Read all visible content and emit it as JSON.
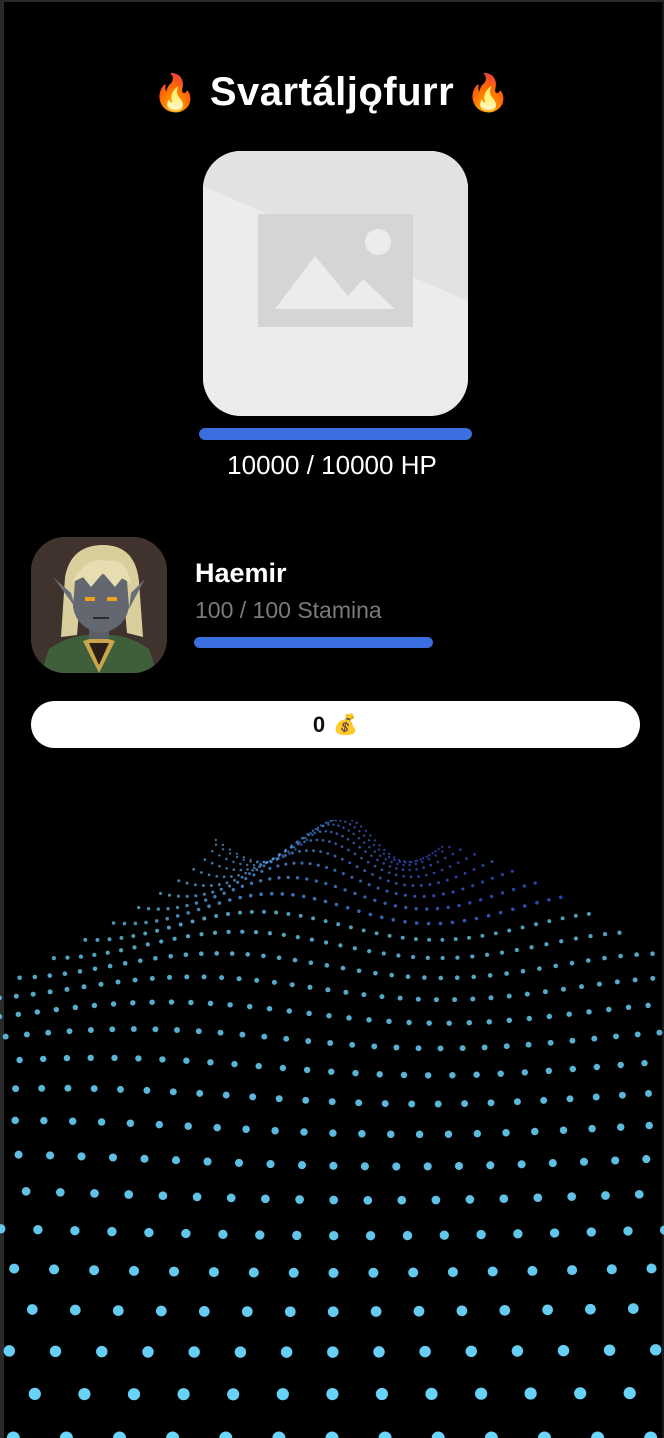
{
  "boss": {
    "title": "Svartáljǫfurr",
    "title_icon": "fire-icon",
    "title_emoji": "🔥",
    "image": "image-placeholder-icon",
    "hp_current": "10000",
    "hp_max": "10000",
    "hp_unit": "HP",
    "hp_separator": " / ",
    "hp_fraction": 1.0
  },
  "player": {
    "name": "Haemir",
    "avatar": "character-portrait",
    "stamina_current": "100",
    "stamina_max": "100",
    "stamina_unit": "Stamina",
    "stamina_separator": " / ",
    "stamina_fraction": 1.0
  },
  "gold": {
    "amount": "0",
    "icon": "money-bag-icon",
    "emoji": "💰"
  },
  "colors": {
    "background": "#000000",
    "bar_fill": "#3b6fe0",
    "gold_pill": "#ffffff",
    "stamina_text": "#7a7a7a",
    "particle_near": "#6fe4ff",
    "particle_far": "#3a5cf0"
  }
}
